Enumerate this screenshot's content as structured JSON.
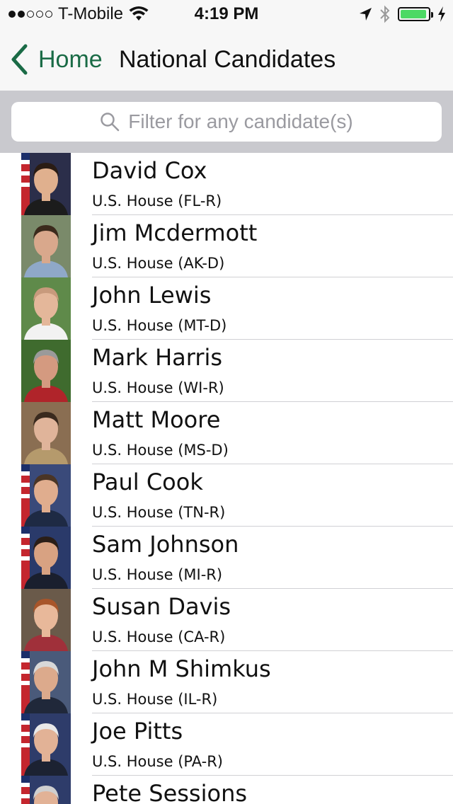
{
  "status_bar": {
    "carrier": "T-Mobile",
    "time": "4:19 PM",
    "signal_bars_filled": 2,
    "signal_bars_total": 5,
    "battery_level": 0.95,
    "icons": [
      "wifi-icon",
      "location-icon",
      "bluetooth-icon",
      "battery-icon",
      "charging-icon"
    ]
  },
  "nav": {
    "back_label": "Home",
    "title": "National Candidates",
    "accent_color": "#1a6b46"
  },
  "search": {
    "placeholder": "Filter for any candidate(s)",
    "value": ""
  },
  "candidates": [
    {
      "name": "David Cox",
      "office": "U.S. House (FL-R)",
      "photo": {
        "bg": "#2b2e4a",
        "skin": "#e0b08e",
        "hair": "#2a1c14",
        "shirt": "#1c1c1c",
        "flag": true
      }
    },
    {
      "name": "Jim Mcdermott",
      "office": "U.S. House (AK-D)",
      "photo": {
        "bg": "#7a8a6a",
        "skin": "#d9a88c",
        "hair": "#3b2a1c",
        "shirt": "#8fa8c8",
        "flag": false
      }
    },
    {
      "name": "John Lewis",
      "office": "U.S. House (MT-D)",
      "photo": {
        "bg": "#5f8a4a",
        "skin": "#e4b79a",
        "hair": "#c89a7c",
        "shirt": "#f2f2f2",
        "flag": false
      }
    },
    {
      "name": "Mark Harris",
      "office": "U.S. House (WI-R)",
      "photo": {
        "bg": "#3f6b2e",
        "skin": "#d49a80",
        "hair": "#9a9a9a",
        "shirt": "#b0242a",
        "flag": false
      }
    },
    {
      "name": "Matt Moore",
      "office": "U.S. House (MS-D)",
      "photo": {
        "bg": "#8a6e52",
        "skin": "#e0b49a",
        "hair": "#3a2a1e",
        "shirt": "#b59a6c",
        "flag": false
      }
    },
    {
      "name": "Paul Cook",
      "office": "U.S. House (TN-R)",
      "photo": {
        "bg": "#3a4a7a",
        "skin": "#e0ad8e",
        "hair": "#4a3526",
        "shirt": "#1e2a44",
        "flag": true
      }
    },
    {
      "name": "Sam Johnson",
      "office": "U.S. House (MI-R)",
      "photo": {
        "bg": "#2a3a6a",
        "skin": "#d8a282",
        "hair": "#2a1e18",
        "shirt": "#1a1f2e",
        "flag": true
      }
    },
    {
      "name": "Susan Davis",
      "office": "U.S. House (CA-R)",
      "photo": {
        "bg": "#6a5a4a",
        "skin": "#e8b89a",
        "hair": "#a8552a",
        "shirt": "#a0303a",
        "flag": false
      }
    },
    {
      "name": "John M Shimkus",
      "office": "U.S. House (IL-R)",
      "photo": {
        "bg": "#4a5a7a",
        "skin": "#dcaa8c",
        "hair": "#d8d8d8",
        "shirt": "#20283a",
        "flag": true
      }
    },
    {
      "name": "Joe Pitts",
      "office": "U.S. House (PA-R)",
      "photo": {
        "bg": "#2e3c6a",
        "skin": "#e2b296",
        "hair": "#e8e8e8",
        "shirt": "#1c2232",
        "flag": true
      }
    },
    {
      "name": "Pete Sessions",
      "office": "",
      "photo": {
        "bg": "#2e3c6a",
        "skin": "#e2b296",
        "hair": "#cfcfcf",
        "shirt": "#1c2232",
        "flag": true
      }
    }
  ]
}
